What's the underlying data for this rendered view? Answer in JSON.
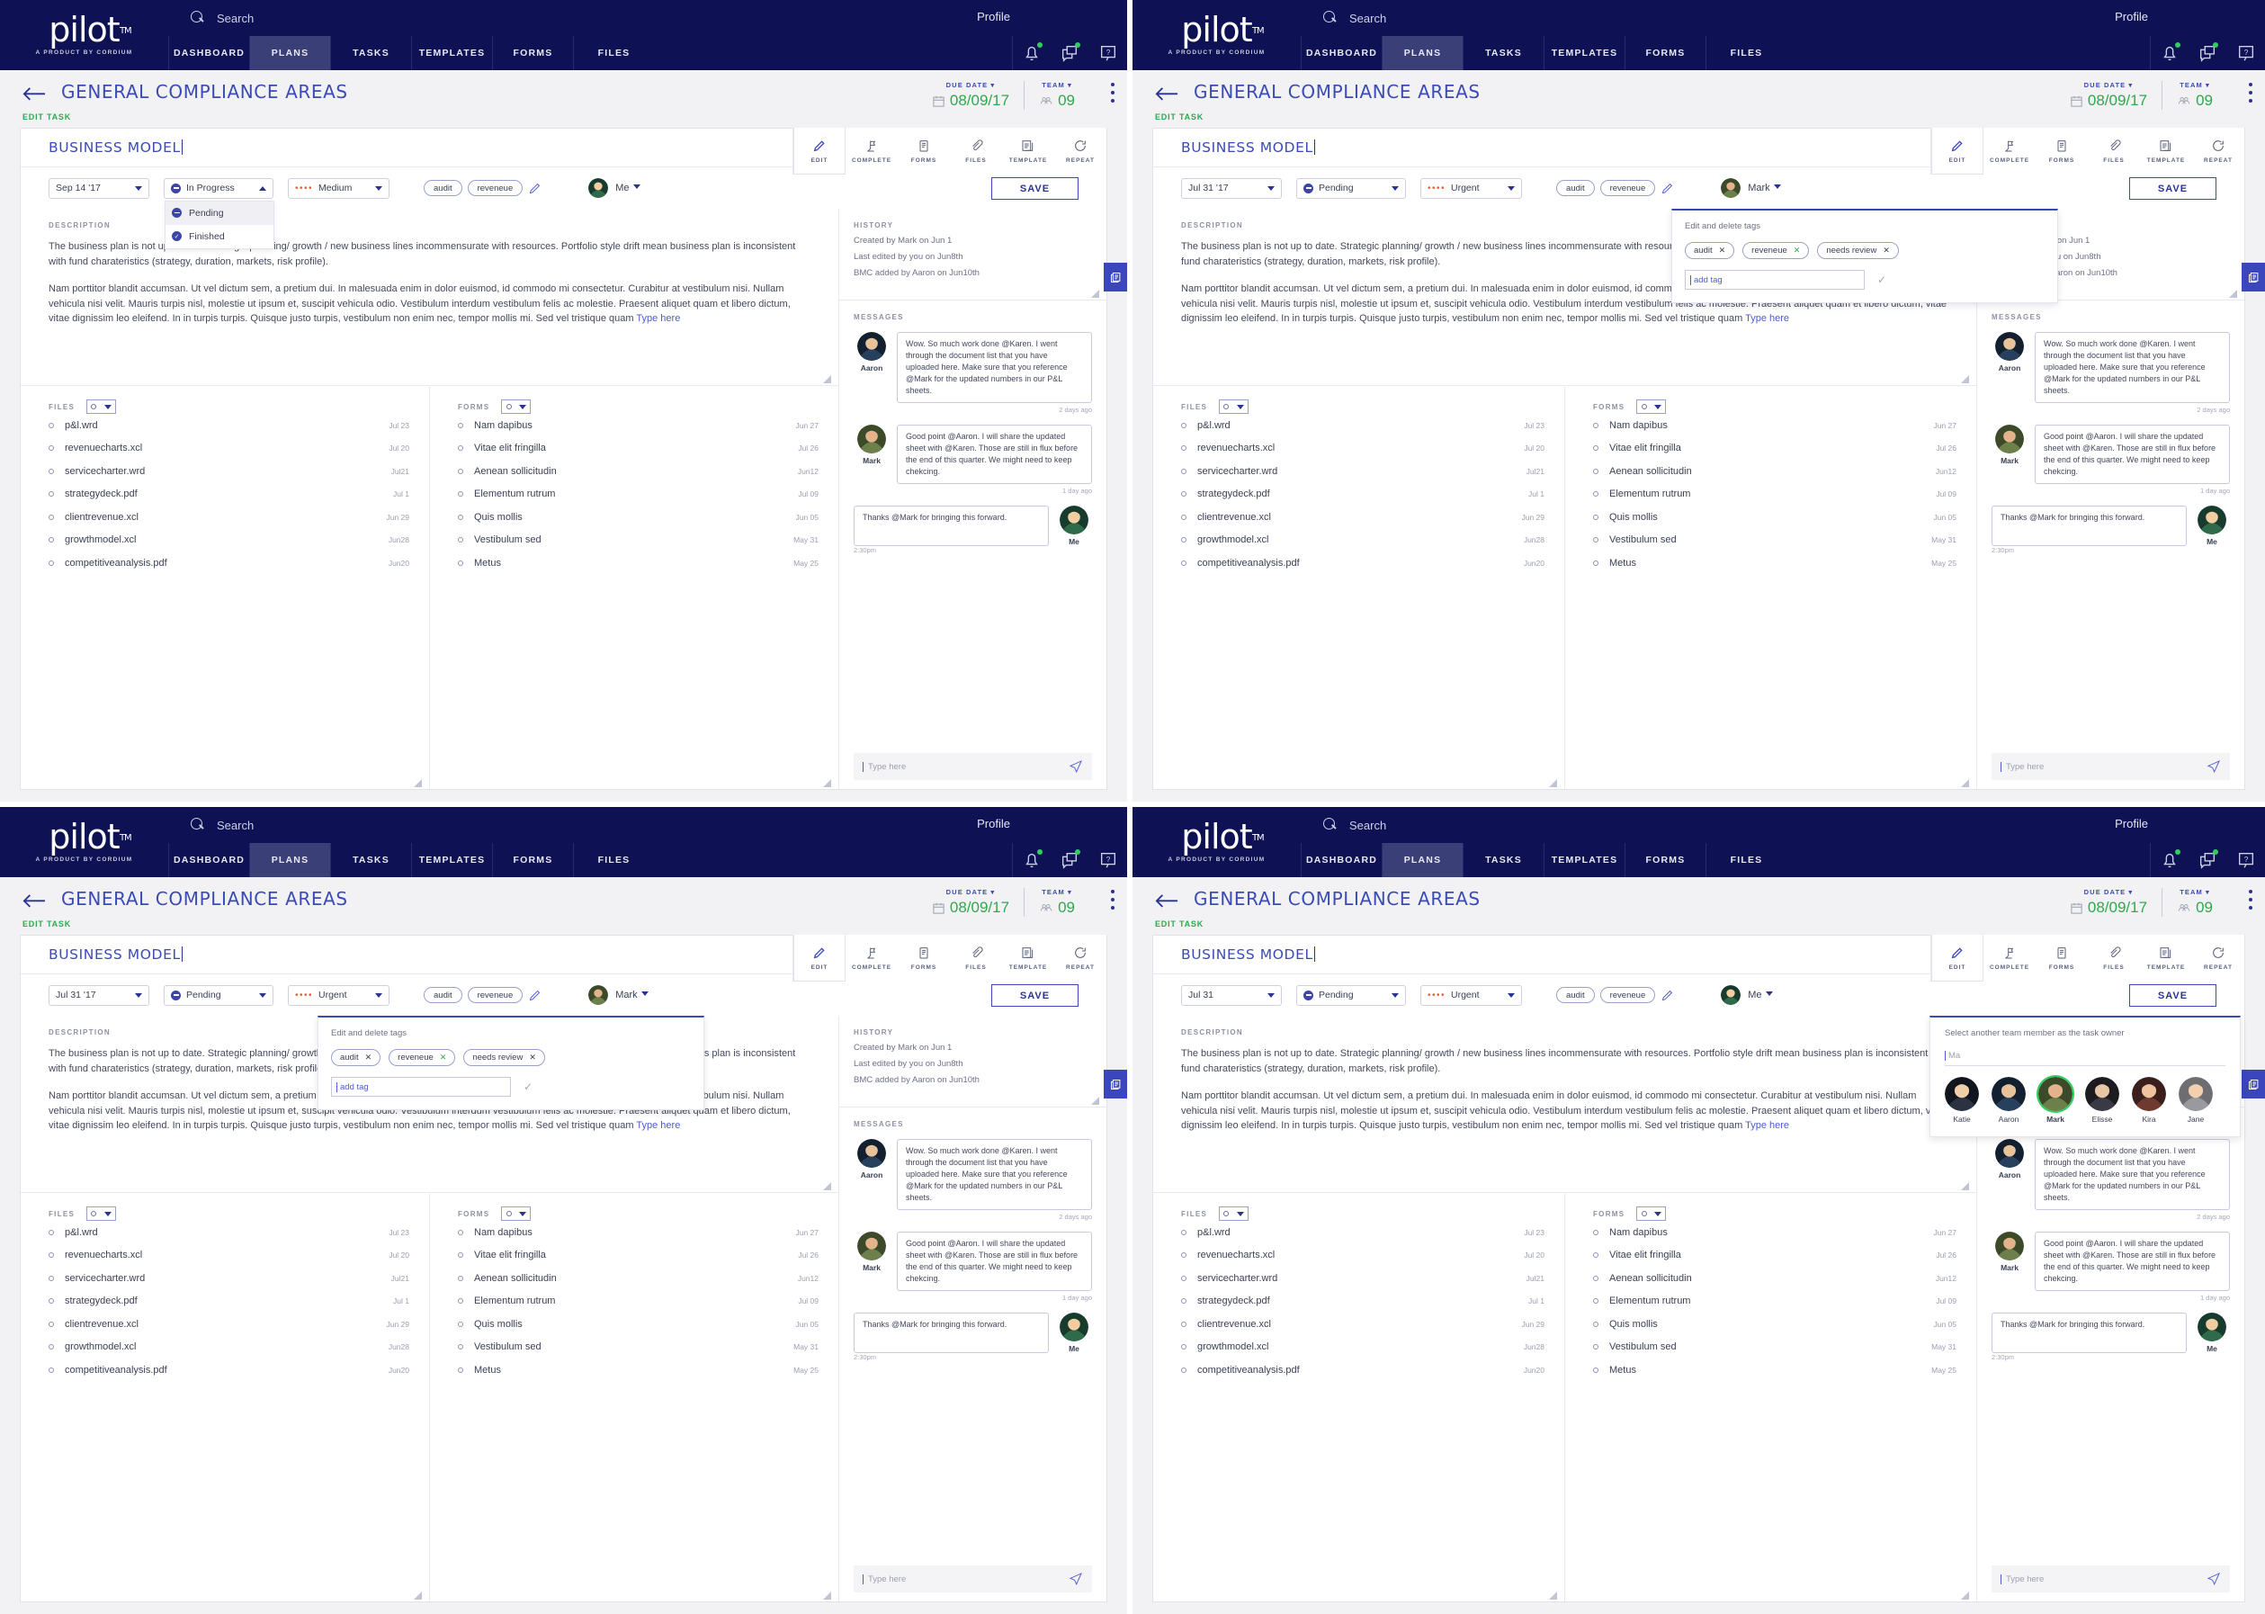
{
  "app": {
    "brand_name": "pilot",
    "brand_tm": "TM",
    "brand_tagline": "A PRODUCT BY CORDIUM",
    "search_placeholder": "Search",
    "profile_label": "Profile",
    "nav_tabs": [
      "DASHBOARD",
      "PLANS",
      "TASKS",
      "TEMPLATES",
      "FORMS",
      "FILES"
    ],
    "active_tab": "PLANS",
    "nav_icons": [
      "bell-icon",
      "chat-icon",
      "help-icon"
    ]
  },
  "page": {
    "title": "GENERAL COMPLIANCE AREAS",
    "subtitle": "EDIT TASK",
    "due_date_label": "DUE DATE",
    "due_date_value": "08/09/17",
    "team_label": "TEAM",
    "team_value": "09"
  },
  "task": {
    "title": "BUSINESS MODEL",
    "save_label": "SAVE",
    "toolbar": [
      {
        "label": "EDIT",
        "icon": "pencil-icon"
      },
      {
        "label": "COMPLETE",
        "icon": "flag-icon"
      },
      {
        "label": "FORMS",
        "icon": "clipboard-icon"
      },
      {
        "label": "FILES",
        "icon": "paperclip-icon"
      },
      {
        "label": "TEMPLATE",
        "icon": "template-icon"
      },
      {
        "label": "REPEAT",
        "icon": "repeat-icon"
      }
    ],
    "status_options": [
      {
        "label": "Pending",
        "icon": "pending-icon"
      },
      {
        "label": "Finished",
        "icon": "check-icon"
      }
    ],
    "tags": [
      "audit",
      "reveneue"
    ],
    "description_label": "DESCRIPTION",
    "description_p1": "The business plan is not up to date. Strategic planning/ growth / new business lines incommensurate with resources. Portfolio style drift mean business plan is inconsistent with fund charateristics (strategy, duration, markets, risk profile).",
    "description_p2": "Nam porttitor blandit accumsan. Ut vel dictum sem, a pretium dui. In malesuada enim in dolor euismod, id commodo mi consectetur. Curabitur at vestibulum nisi. Nullam vehicula nisi velit. Mauris turpis nisl, molestie ut ipsum et, suscipit vehicula odio. Vestibulum interdum vestibulum felis ac molestie. Praesent aliquet quam et libero dictum, vitae dignissim leo eleifend. In in turpis turpis. Quisque justo turpis, vestibulum non enim nec, tempor mollis mi. Sed vel tristique quam ",
    "description_typehere": "Type here"
  },
  "files": {
    "label": "FILES",
    "items": [
      {
        "name": "p&l.wrd",
        "date": "Jul 23"
      },
      {
        "name": "revenuecharts.xcl",
        "date": "Jul 20"
      },
      {
        "name": "servicecharter.wrd",
        "date": "Jul21"
      },
      {
        "name": "strategydeck.pdf",
        "date": "Jul 1"
      },
      {
        "name": "clientrevenue.xcl",
        "date": "Jun 29"
      },
      {
        "name": "growthmodel.xcl",
        "date": "Jun28"
      },
      {
        "name": "competitiveanalysis.pdf",
        "date": "Jun20"
      }
    ]
  },
  "forms": {
    "label": "FORMS",
    "items": [
      {
        "name": "Nam dapibus",
        "date": "Jun 27"
      },
      {
        "name": "Vitae elit fringilla",
        "date": "Jul 26"
      },
      {
        "name": "Aenean sollicitudin",
        "date": "Jun12"
      },
      {
        "name": "Elementum rutrum",
        "date": "Jul 09"
      },
      {
        "name": "Quis mollis",
        "date": "Jun 05"
      },
      {
        "name": "Vestibulum sed",
        "date": "May 31"
      },
      {
        "name": "Metus",
        "date": "May 25"
      }
    ]
  },
  "history": {
    "label": "HISTORY",
    "lines": [
      "Created by Mark on Jun 1",
      "Last edited by you on Jun8th",
      "BMC added by Aaron on Jun10th"
    ]
  },
  "messages": {
    "label": "MESSAGES",
    "items": [
      {
        "author": "Aaron",
        "text": "Wow. So much work done @Karen. I went through the document list that you have uploaded here. Make sure that you reference @Mark for the updated numbers in our P&L sheets.",
        "time": "2 days ago",
        "mine": false
      },
      {
        "author": "Mark",
        "text": "Good point @Aaron. I will share the updated sheet with @Karen. Those are still in flux before the end of this quarter. We might need to keep chekcing.",
        "time": "1 day ago",
        "mine": false
      },
      {
        "author": "Me",
        "text": "Thanks @Mark for bringing this forward.",
        "time": "2:30pm",
        "mine": true
      }
    ],
    "composer_placeholder": "Type here"
  },
  "tag_popup": {
    "title": "Edit and delete tags",
    "chips": [
      "audit",
      "reveneue",
      "needs review"
    ],
    "input_value": "add tag"
  },
  "owner_popup": {
    "title": "Select another team member as the task owner",
    "input_value": "Ma",
    "people": [
      "Katie",
      "Aaron",
      "Mark",
      "Elisse",
      "Kira",
      "Jane"
    ],
    "selected": "Mark"
  },
  "panels": [
    {
      "id": "panel-1",
      "date": "Sep 14 '17",
      "status": "In Progress",
      "priority": "Medium",
      "owner": "Me",
      "status_open": true,
      "tag_popup_open": false,
      "owner_popup_open": false
    },
    {
      "id": "panel-2",
      "date": "Jul 31 '17",
      "status": "Pending",
      "priority": "Urgent",
      "owner": "Mark",
      "status_open": false,
      "tag_popup_open": true,
      "owner_popup_open": false
    },
    {
      "id": "panel-3",
      "date": "Jul 31 '17",
      "status": "Pending",
      "priority": "Urgent",
      "owner": "Mark",
      "status_open": false,
      "tag_popup_open": true,
      "owner_popup_open": false
    },
    {
      "id": "panel-4",
      "date": "Jul 31",
      "status": "Pending",
      "priority": "Urgent",
      "owner": "Me",
      "status_open": false,
      "tag_popup_open": false,
      "owner_popup_open": true
    }
  ]
}
